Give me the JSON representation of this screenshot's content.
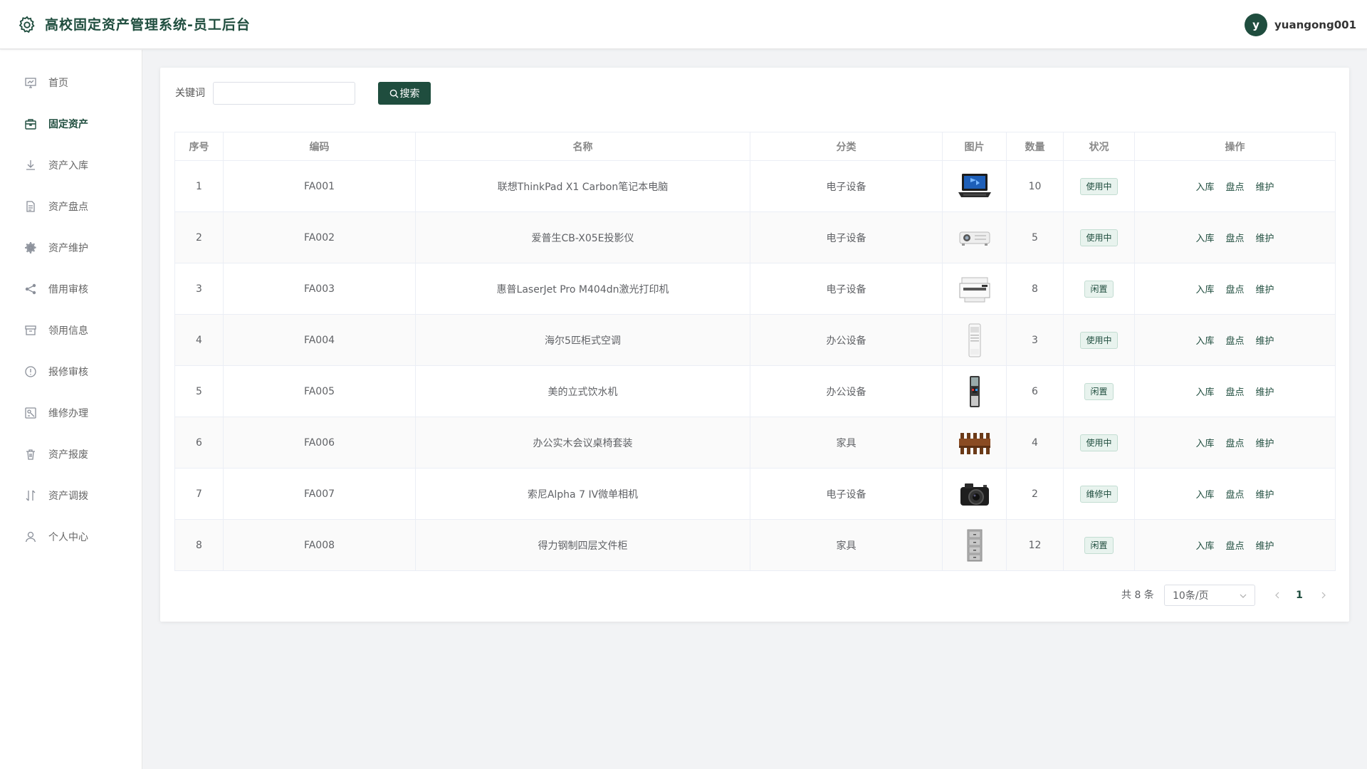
{
  "header": {
    "title": "高校固定资产管理系统-员工后台",
    "avatar_letter": "y",
    "username": "yuangong001"
  },
  "sidebar": {
    "items": [
      {
        "label": "首页",
        "icon": "chart-icon"
      },
      {
        "label": "固定资产",
        "icon": "package-icon",
        "active": true
      },
      {
        "label": "资产入库",
        "icon": "download-icon"
      },
      {
        "label": "资产盘点",
        "icon": "document-icon"
      },
      {
        "label": "资产维护",
        "icon": "gear-icon"
      },
      {
        "label": "借用审核",
        "icon": "share-icon"
      },
      {
        "label": "领用信息",
        "icon": "archive-icon"
      },
      {
        "label": "报修审核",
        "icon": "warning-icon"
      },
      {
        "label": "维修办理",
        "icon": "wrench-icon"
      },
      {
        "label": "资产报废",
        "icon": "trash-icon"
      },
      {
        "label": "资产调拨",
        "icon": "transfer-icon"
      },
      {
        "label": "个人中心",
        "icon": "user-icon"
      }
    ]
  },
  "search": {
    "label": "关键词",
    "value": "",
    "button_label": "搜索"
  },
  "table": {
    "columns": [
      "序号",
      "编码",
      "名称",
      "分类",
      "图片",
      "数量",
      "状况",
      "操作"
    ],
    "actions": [
      "入库",
      "盘点",
      "维护"
    ],
    "rows": [
      {
        "index": "1",
        "code": "FA001",
        "name": "联想ThinkPad X1 Carbon笔记本电脑",
        "category": "电子设备",
        "image": "laptop",
        "qty": "10",
        "status": "使用中"
      },
      {
        "index": "2",
        "code": "FA002",
        "name": "爱普生CB-X05E投影仪",
        "category": "电子设备",
        "image": "projector",
        "qty": "5",
        "status": "使用中"
      },
      {
        "index": "3",
        "code": "FA003",
        "name": "惠普LaserJet Pro M404dn激光打印机",
        "category": "电子设备",
        "image": "printer",
        "qty": "8",
        "status": "闲置"
      },
      {
        "index": "4",
        "code": "FA004",
        "name": "海尔5匹柜式空调",
        "category": "办公设备",
        "image": "air-conditioner",
        "qty": "3",
        "status": "使用中"
      },
      {
        "index": "5",
        "code": "FA005",
        "name": "美的立式饮水机",
        "category": "办公设备",
        "image": "water-dispenser",
        "qty": "6",
        "status": "闲置"
      },
      {
        "index": "6",
        "code": "FA006",
        "name": "办公实木会议桌椅套装",
        "category": "家具",
        "image": "conference-table",
        "qty": "4",
        "status": "使用中"
      },
      {
        "index": "7",
        "code": "FA007",
        "name": "索尼Alpha 7 IV微单相机",
        "category": "电子设备",
        "image": "camera",
        "qty": "2",
        "status": "维修中"
      },
      {
        "index": "8",
        "code": "FA008",
        "name": "得力钢制四层文件柜",
        "category": "家具",
        "image": "file-cabinet",
        "qty": "12",
        "status": "闲置"
      }
    ]
  },
  "pagination": {
    "total_text": "共 8 条",
    "page_size": "10条/页",
    "current_page": "1"
  },
  "colors": {
    "primary": "#1f4d3e",
    "badge_bg": "#e8f3ee"
  }
}
